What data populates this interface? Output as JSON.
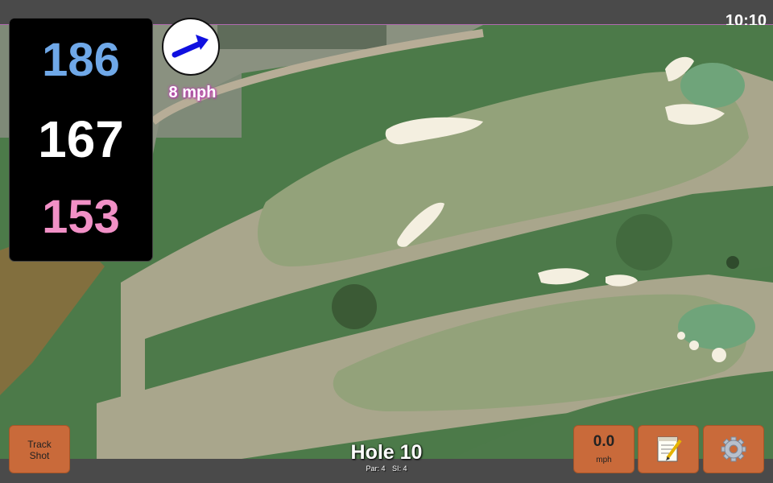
{
  "status_bar": {
    "time": "10:10"
  },
  "distances": {
    "back": "186",
    "middle": "167",
    "front": "153"
  },
  "wind": {
    "speed": "8 mph",
    "direction_icon": "arrow-icon"
  },
  "buttons": {
    "track_shot_line1": "Track",
    "track_shot_line2": "Shot",
    "speed_value": "0.0",
    "speed_unit": "mph",
    "notes_icon": "notepad-icon",
    "settings_icon": "gear-icon"
  },
  "hole": {
    "title": "Hole 10",
    "par": "Par: 4",
    "si": "SI: 4"
  },
  "colors": {
    "back": "#6fa8e8",
    "middle": "#ffffff",
    "front": "#f190c6",
    "button": "#c96a3a",
    "wind_text_glow": "#c04ab5"
  }
}
